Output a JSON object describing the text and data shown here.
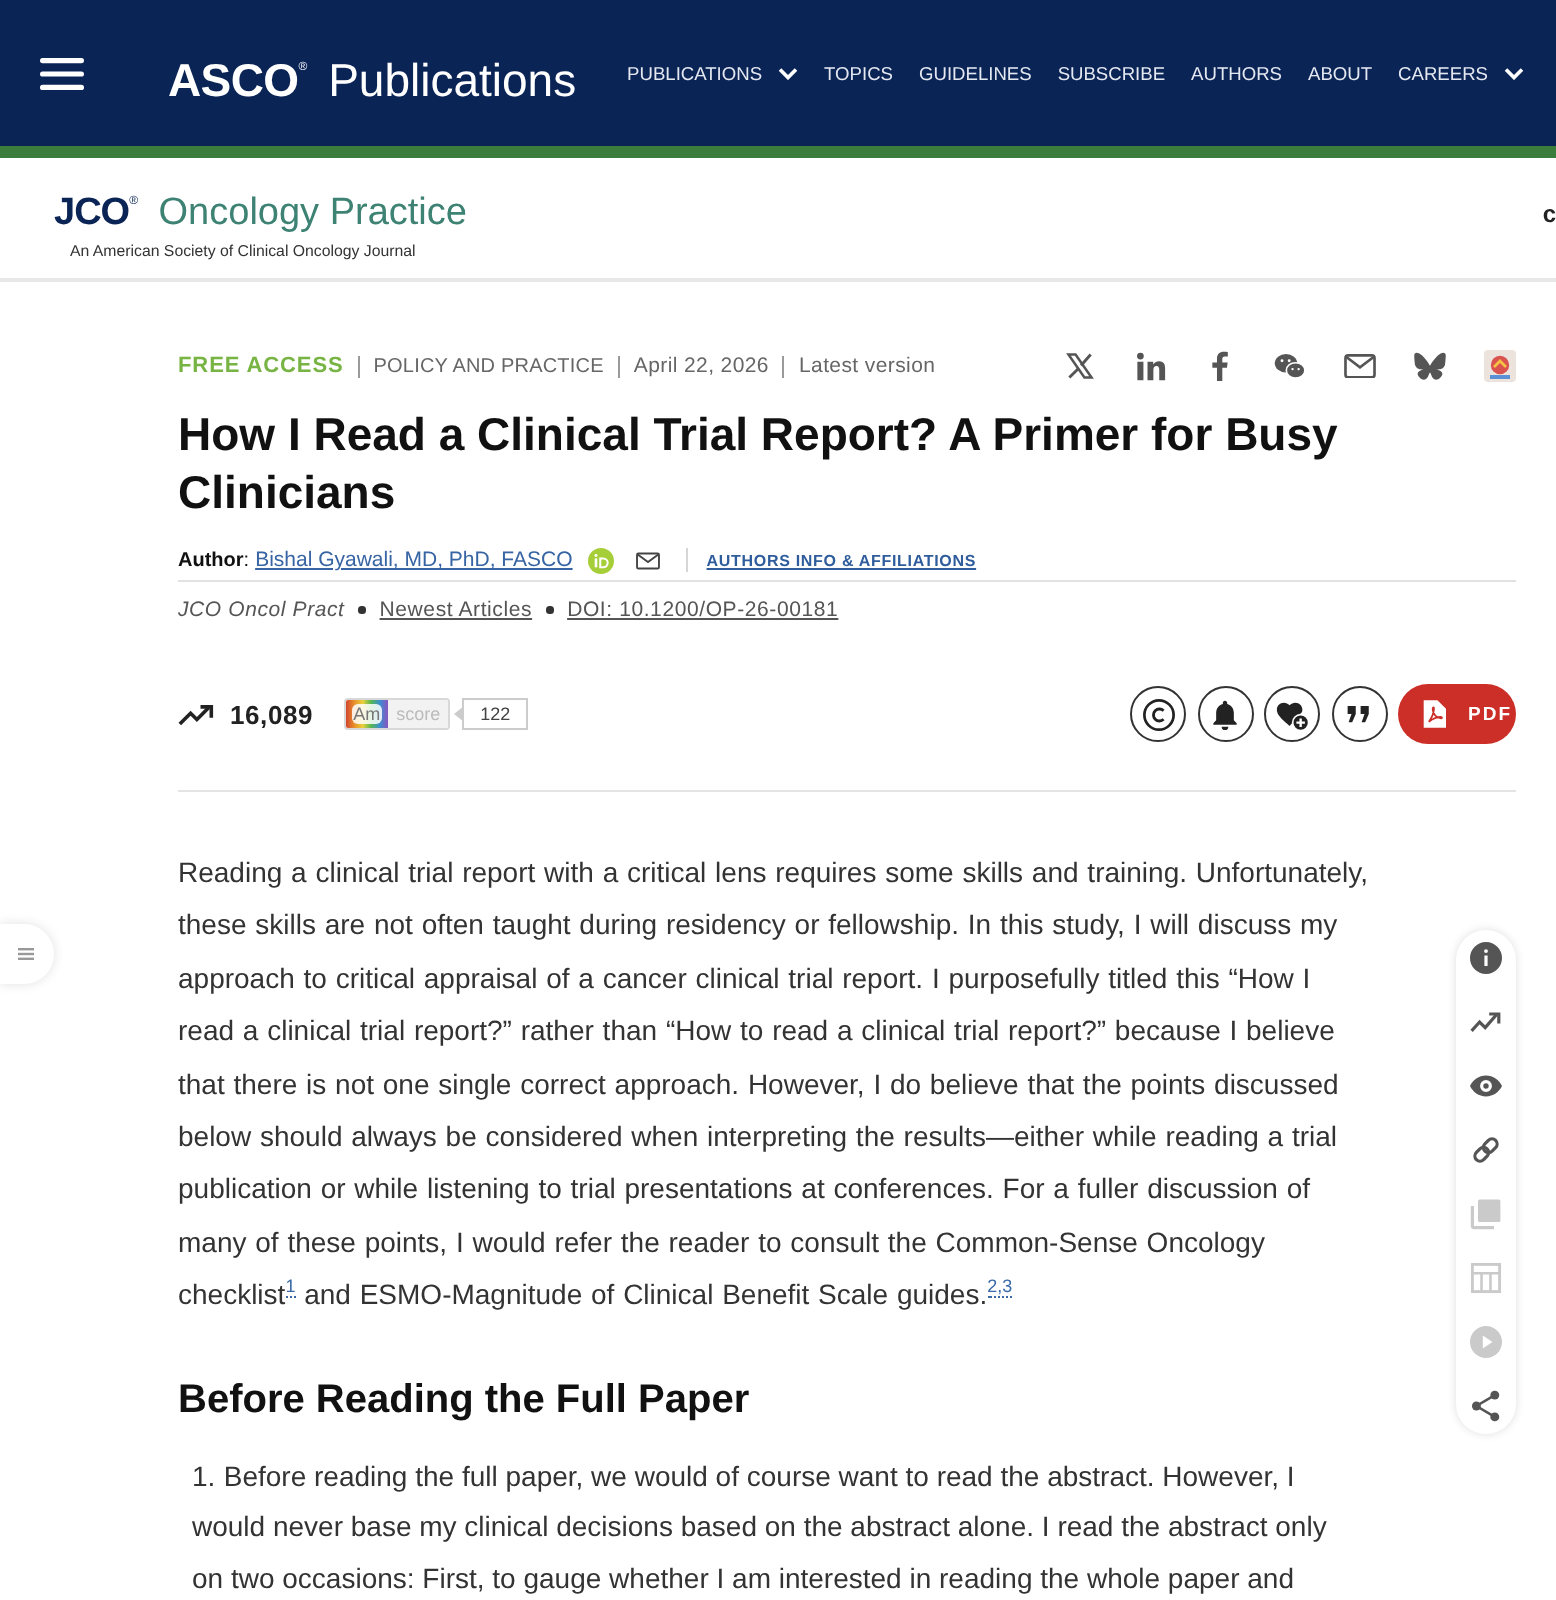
{
  "top_nav": {
    "brand": "**ASCO**$^{®}$ Publications",
    "items": [
      {
        "label": "PUBLICATIONS",
        "dropdown": true
      },
      {
        "label": "TOPICS",
        "dropdown": false
      },
      {
        "label": "GUIDELINES",
        "dropdown": false
      },
      {
        "label": "SUBSCRIBE",
        "dropdown": false
      },
      {
        "label": "AUTHORS",
        "dropdown": false
      },
      {
        "label": "ABOUT",
        "dropdown": false
      },
      {
        "label": "CAREERS",
        "dropdown": true
      }
    ]
  },
  "journal_banner": {
    "logo": "**JCO**$^{®}$ Oncology Practice",
    "tagline": "An American Society of Clinical Oncology Journal",
    "edge_text": "c"
  },
  "article": {
    "access": "FREE ACCESS",
    "section": "POLICY AND PRACTICE",
    "date": "April 22, 2026",
    "version": "Latest version",
    "share": [
      {
        "kind": "x"
      },
      {
        "kind": "linkedin"
      },
      {
        "kind": "facebook"
      },
      {
        "kind": "wechat"
      },
      {
        "kind": "email"
      },
      {
        "kind": "bluesky"
      },
      {
        "kind": "app"
      }
    ],
    "title": "How I Read a Clinical Trial Report? A Primer for Busy Clinicians",
    "byline": {
      "label": "**Author**:",
      "name": "Bishal Gyawali, MD, PhD, FASCO",
      "orcid": true,
      "email": true,
      "affiliations": "AUTHORS INFO & AFFILIATIONS"
    },
    "citation": {
      "journal": "JCO Oncol Pract",
      "issue": "Newest Articles",
      "doi": "DOI: 10.1200/OP-26-00181"
    },
    "metrics": {
      "views": "16,089",
      "altmetric": {
        "logo": "Am",
        "label": "score",
        "count": "122"
      }
    },
    "actions": [
      {
        "kind": "copyright"
      },
      {
        "kind": "alert"
      },
      {
        "kind": "favorite"
      },
      {
        "kind": "cite"
      },
      {
        "kind": "pdf",
        "label": "PDF"
      }
    ]
  },
  "body": {
    "intro": [
      {
        "kind": "text",
        "text": "Reading a clinical trial report with a critical lens requires some skills and training. Unfortunately, these skills are not often taught during residency or fellowship. In this study, I will discuss my approach to critical appraisal of a cancer clinical trial report. I purposefully titled this “How I read a clinical trial report?” rather than “How to read a clinical trial report?” because I believe that there is not one single correct approach. However, I do believe that the points discussed below should always be considered when interpreting the results—either while reading a trial publication or while listening to trial presentations at conferences. For a fuller discussion of many of these points, I would refer the reader to consult the Common-Sense Oncology checklist"
      },
      {
        "kind": "ref",
        "text": "1"
      },
      {
        "kind": "text",
        "text": " and ESMO-Magnitude of Clinical Benefit Scale guides."
      },
      {
        "kind": "ref",
        "text": "2,3"
      }
    ],
    "heading": "Before Reading the Full Paper",
    "list": [
      {
        "number": "1.",
        "text": "Before reading the full paper, we would of course want to read the abstract. However, I would never base my clinical decisions based on the abstract alone. I read the abstract only on two occasions: First, to gauge whether I am interested in reading the whole paper and"
      }
    ]
  },
  "side_tools": [
    {
      "kind": "info",
      "disabled": false
    },
    {
      "kind": "trend",
      "disabled": false
    },
    {
      "kind": "eye",
      "disabled": false
    },
    {
      "kind": "link",
      "disabled": false
    },
    {
      "kind": "images",
      "disabled": true
    },
    {
      "kind": "table",
      "disabled": true
    },
    {
      "kind": "play",
      "disabled": true
    },
    {
      "kind": "share",
      "disabled": false
    }
  ]
}
